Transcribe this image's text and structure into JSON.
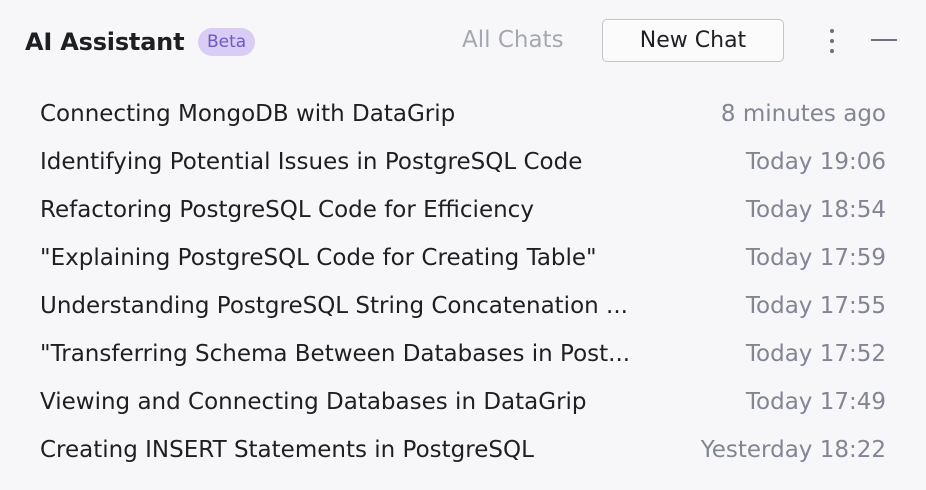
{
  "header": {
    "title": "AI Assistant",
    "badge": "Beta",
    "all_chats_label": "All Chats",
    "new_chat_label": "New Chat",
    "more_icon": "more-vertical-icon",
    "minimize_icon": "minimize-icon"
  },
  "chats": [
    {
      "title": "Connecting MongoDB with DataGrip",
      "time": "8 minutes ago"
    },
    {
      "title": "Identifying Potential Issues in PostgreSQL Code",
      "time": "Today 19:06"
    },
    {
      "title": "Refactoring PostgreSQL Code for Efficiency",
      "time": "Today 18:54"
    },
    {
      "title": "\"Explaining PostgreSQL Code for Creating Table\"",
      "time": "Today 17:59"
    },
    {
      "title": "Understanding PostgreSQL String Concatenation ...",
      "time": "Today 17:55"
    },
    {
      "title": "\"Transferring Schema Between Databases in Post...",
      "time": "Today 17:52"
    },
    {
      "title": "Viewing and Connecting Databases in DataGrip",
      "time": "Today 17:49"
    },
    {
      "title": "Creating INSERT Statements in PostgreSQL",
      "time": "Yesterday 18:22"
    }
  ],
  "colors": {
    "background": "#f7f7f9",
    "text_primary": "#1e1f22",
    "text_secondary": "#818594",
    "badge_background": "#d9cdf6",
    "badge_text": "#6f58c2"
  }
}
